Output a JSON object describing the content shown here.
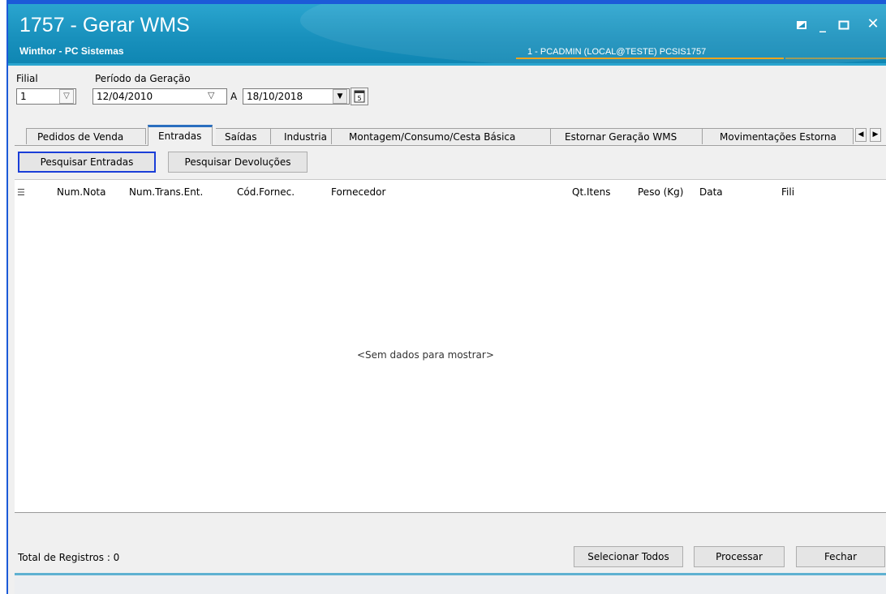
{
  "window": {
    "title": "1757 - Gerar WMS",
    "subtitle": "Winthor - PC Sistemas",
    "user_info": "1 - PCADMIN (LOCAL@TESTE)  PCSIS1757",
    "controls": {
      "restore_icon": "restore-icon",
      "minimize_icon": "minimize-icon",
      "maximize_icon": "maximize-icon",
      "close_icon": "close-icon"
    }
  },
  "filters": {
    "filial_label": "Filial",
    "filial_value": "1",
    "periodo_label": "Período da Geração",
    "date_from": "12/04/2010",
    "separator": "A",
    "date_to": "18/10/2018"
  },
  "tabs": [
    {
      "label": "Pedidos de Venda",
      "active": false
    },
    {
      "label": "Entradas",
      "active": true
    },
    {
      "label": "Saídas",
      "active": false
    },
    {
      "label": "Industria",
      "active": false
    },
    {
      "label": "Montagem/Consumo/Cesta Básica",
      "active": false
    },
    {
      "label": "Estornar Geração WMS",
      "active": false
    },
    {
      "label": "Movimentações Estorna",
      "active": false
    }
  ],
  "actions": {
    "pesquisar_entradas": "Pesquisar Entradas",
    "pesquisar_devolucoes": "Pesquisar Devoluções"
  },
  "grid": {
    "columns": [
      "Num.Nota",
      "Num.Trans.Ent.",
      "Cód.Fornec.",
      "Fornecedor",
      "Qt.Itens",
      "Peso (Kg)",
      "Data",
      "Fili"
    ],
    "empty_text": "<Sem dados para mostrar>"
  },
  "footer": {
    "total_label": "Total de Registros : 0",
    "selecionar_todos": "Selecionar Todos",
    "processar": "Processar",
    "fechar": "Fechar"
  },
  "colors": {
    "title_bar": "#1991bd",
    "accent_line": "#f2a41e",
    "focus_border": "#1a3ed8"
  }
}
